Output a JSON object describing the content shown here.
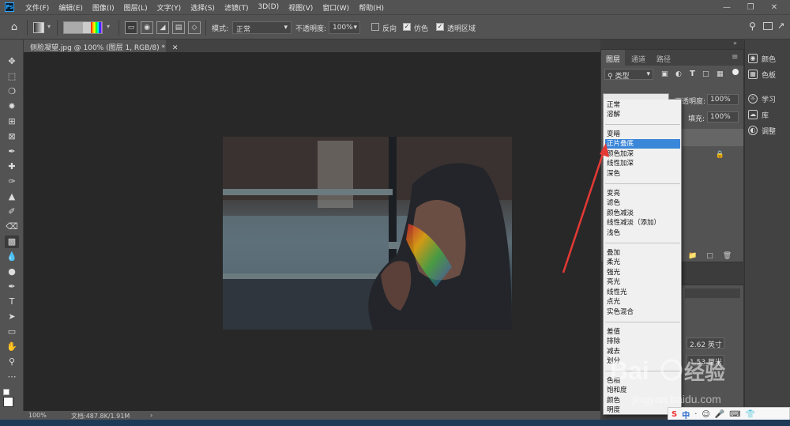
{
  "app": {
    "logo_text": "Ps",
    "menu": [
      "文件(F)",
      "编辑(E)",
      "图像(I)",
      "图层(L)",
      "文字(Y)",
      "选择(S)",
      "滤镜(T)",
      "3D(D)",
      "视图(V)",
      "窗口(W)",
      "帮助(H)"
    ]
  },
  "options_bar": {
    "mode_label": "模式:",
    "mode_value": "正常",
    "opacity_label": "不透明度:",
    "opacity_value": "100%",
    "reverse_label": "反向",
    "dither_label": "仿色",
    "transparency_label": "透明区域",
    "reverse_checked": false,
    "dither_checked": true,
    "transparency_checked": true
  },
  "document": {
    "tab_title": "侧脸凝望.jpg @ 100% (图层 1, RGB/8) *",
    "zoom": "100%",
    "doc_info": "文档:487.8K/1.91M"
  },
  "layers_panel": {
    "tabs": [
      "图层",
      "通道",
      "路径"
    ],
    "filter_label": "类型",
    "opacity_label": "不透明度:",
    "opacity_value": "100%",
    "fill_label": "填充:",
    "fill_value": "100%"
  },
  "props_panel": {
    "width_value": "2.62 英寸",
    "height_value": "1.53 厘米"
  },
  "minidock": [
    {
      "icon": "color-icon",
      "label": "颜色"
    },
    {
      "icon": "swatches-icon",
      "label": "色板"
    },
    {
      "icon": "learn-icon",
      "label": "学习"
    },
    {
      "icon": "libraries-icon",
      "label": "库"
    },
    {
      "icon": "adjustments-icon",
      "label": "调整"
    }
  ],
  "blend_modes": {
    "selected": "正片叠底",
    "groups": [
      [
        "正常",
        "溶解"
      ],
      [
        "变暗",
        "正片叠底",
        "颜色加深",
        "线性加深",
        "深色"
      ],
      [
        "变亮",
        "滤色",
        "颜色减淡",
        "线性减淡（添加）",
        "浅色"
      ],
      [
        "叠加",
        "柔光",
        "强光",
        "亮光",
        "线性光",
        "点光",
        "实色混合"
      ],
      [
        "差值",
        "排除",
        "减去",
        "划分"
      ],
      [
        "色相",
        "饱和度",
        "颜色",
        "明度"
      ]
    ]
  },
  "watermark": {
    "brand": "Bai",
    "brand2": "经验",
    "url": "jingyan.baidu.com"
  },
  "ime": {
    "label": "中"
  },
  "colors": {
    "accent_selected": "#3a86d8",
    "arrow": "#e53935",
    "ps_blue": "#31a8ff"
  }
}
